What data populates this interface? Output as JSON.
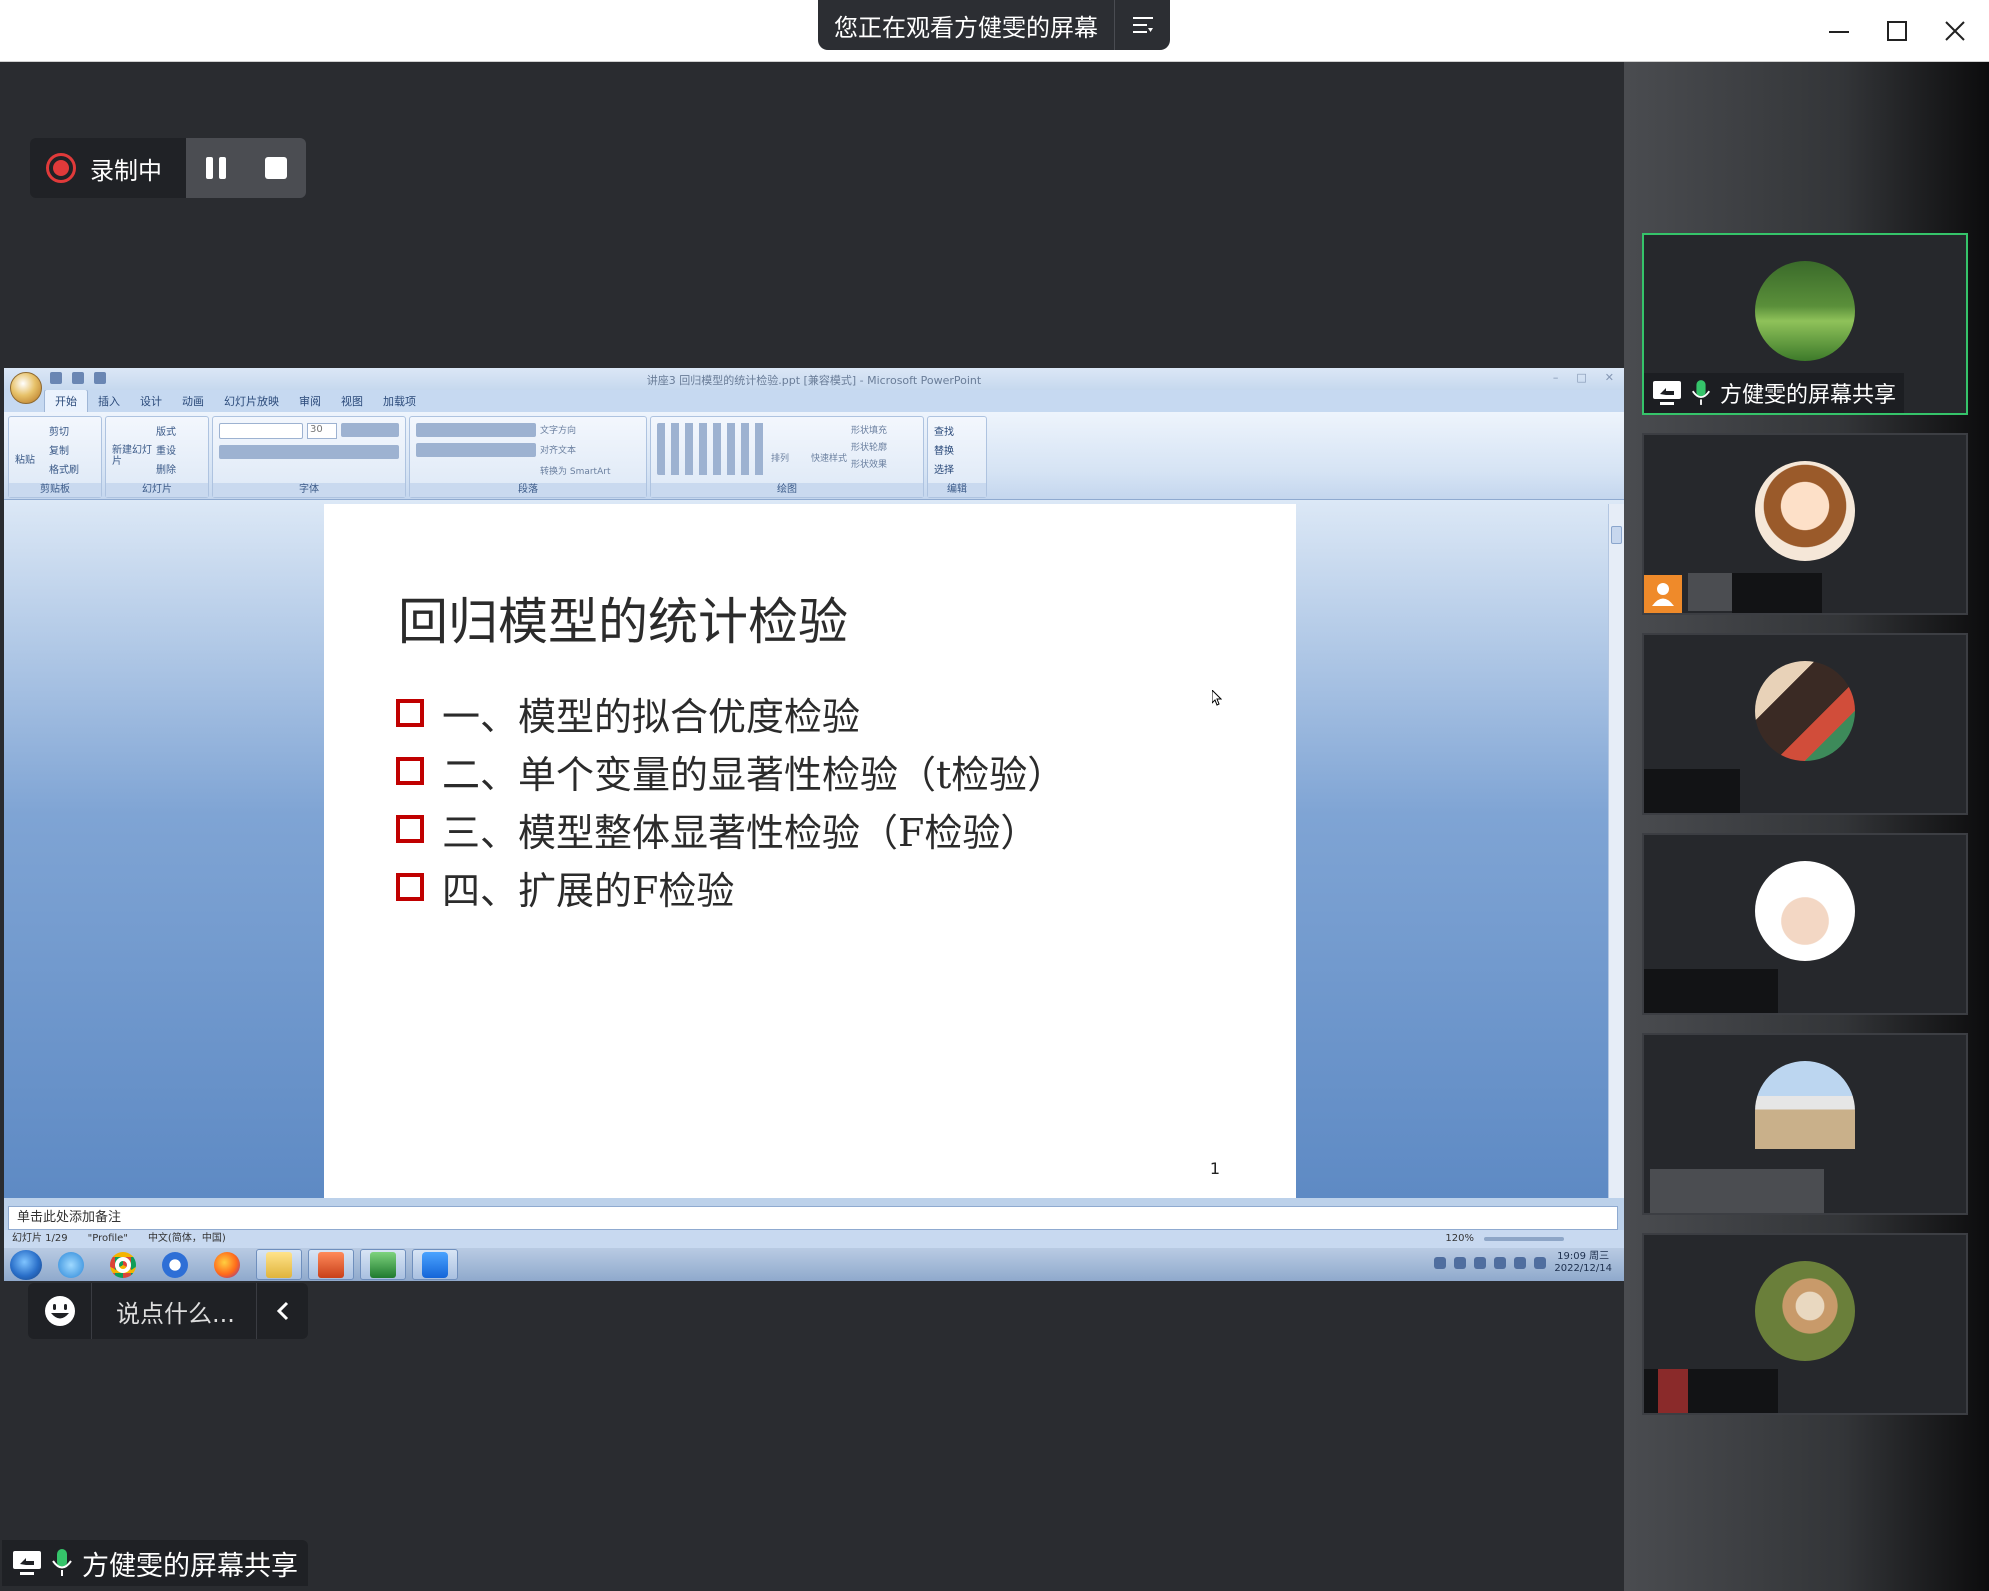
{
  "window": {
    "banner": "您正在观看方健雯的屏幕",
    "icons": [
      "menu-icon",
      "minimize-icon",
      "maximize-icon",
      "close-icon"
    ]
  },
  "recording": {
    "status": "录制中",
    "color": "#e03a3a"
  },
  "powerpoint": {
    "window_title": "讲座3 回归模型的统计检验.ppt [兼容模式] - Microsoft PowerPoint",
    "tabs": [
      "开始",
      "插入",
      "设计",
      "动画",
      "幻灯片放映",
      "审阅",
      "视图",
      "加载项"
    ],
    "ribbon_groups": [
      "剪贴板",
      "幻灯片",
      "字体",
      "段落",
      "绘图",
      "编辑"
    ],
    "clipboard": {
      "paste": "粘贴",
      "cut": "剪切",
      "copy": "复制",
      "format_painter": "格式刷"
    },
    "slides_group": {
      "new_slide": "新建幻灯片",
      "layout": "版式",
      "reset": "重设",
      "delete": "删除"
    },
    "font": {
      "size": "30"
    },
    "paragraph": {
      "text_direction": "文字方向",
      "align_text": "对齐文本",
      "smartart": "转换为 SmartArt"
    },
    "drawing": {
      "arrange": "排列",
      "quick_styles": "快速样式",
      "shape_fill": "形状填充",
      "shape_outline": "形状轮廓",
      "shape_effects": "形状效果"
    },
    "editing": {
      "find": "查找",
      "replace": "替换",
      "select": "选择"
    },
    "slide": {
      "title": "回归模型的统计检验",
      "bullets": [
        "一、模型的拟合优度检验",
        "二、单个变量的显著性检验（t检验）",
        "三、模型整体显著性检验（F检验）",
        "四、扩展的F检验"
      ],
      "number": "1"
    },
    "notes_placeholder": "单击此处添加备注",
    "status": {
      "slide_count": "幻灯片 1/29",
      "theme": "\"Profile\"",
      "language": "中文(简体，中国)",
      "zoom": "120%"
    },
    "clock": {
      "time": "19:09 周三",
      "date": "2022/12/14"
    },
    "bullet_color": "#c00000"
  },
  "chat": {
    "placeholder": "说点什么..."
  },
  "sharer_label": "方健雯的屏幕共享",
  "participants": [
    {
      "name": "方健雯的屏幕共享",
      "active": true,
      "accent": "#35c46a"
    },
    {
      "name": ""
    },
    {
      "name": ""
    },
    {
      "name": ""
    },
    {
      "name": ""
    },
    {
      "name": ""
    }
  ]
}
